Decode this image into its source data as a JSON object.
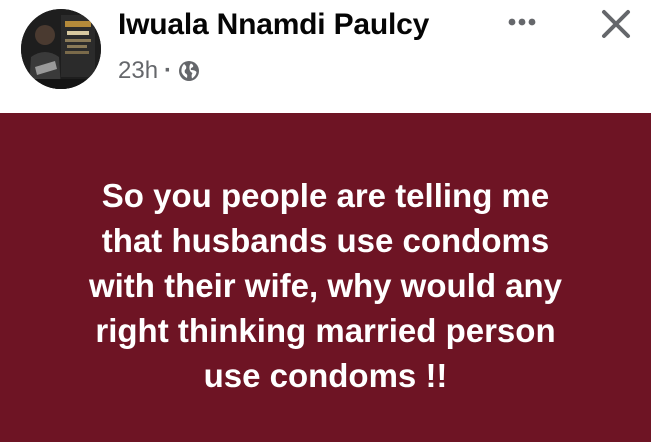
{
  "post": {
    "author_name": "Iwuala Nnamdi Paulcy",
    "timestamp": "23h",
    "separator": "·",
    "privacy_icon": "globe-icon",
    "more_icon": "more-options-icon",
    "close_icon": "close-icon",
    "avatar_icon": "profile-photo"
  },
  "card": {
    "background_color": "#6e1424",
    "text_color": "#ffffff",
    "text": "So you people are telling me\nthat husbands use condoms\nwith their wife, why would any\nright thinking married person\nuse condoms !!"
  }
}
